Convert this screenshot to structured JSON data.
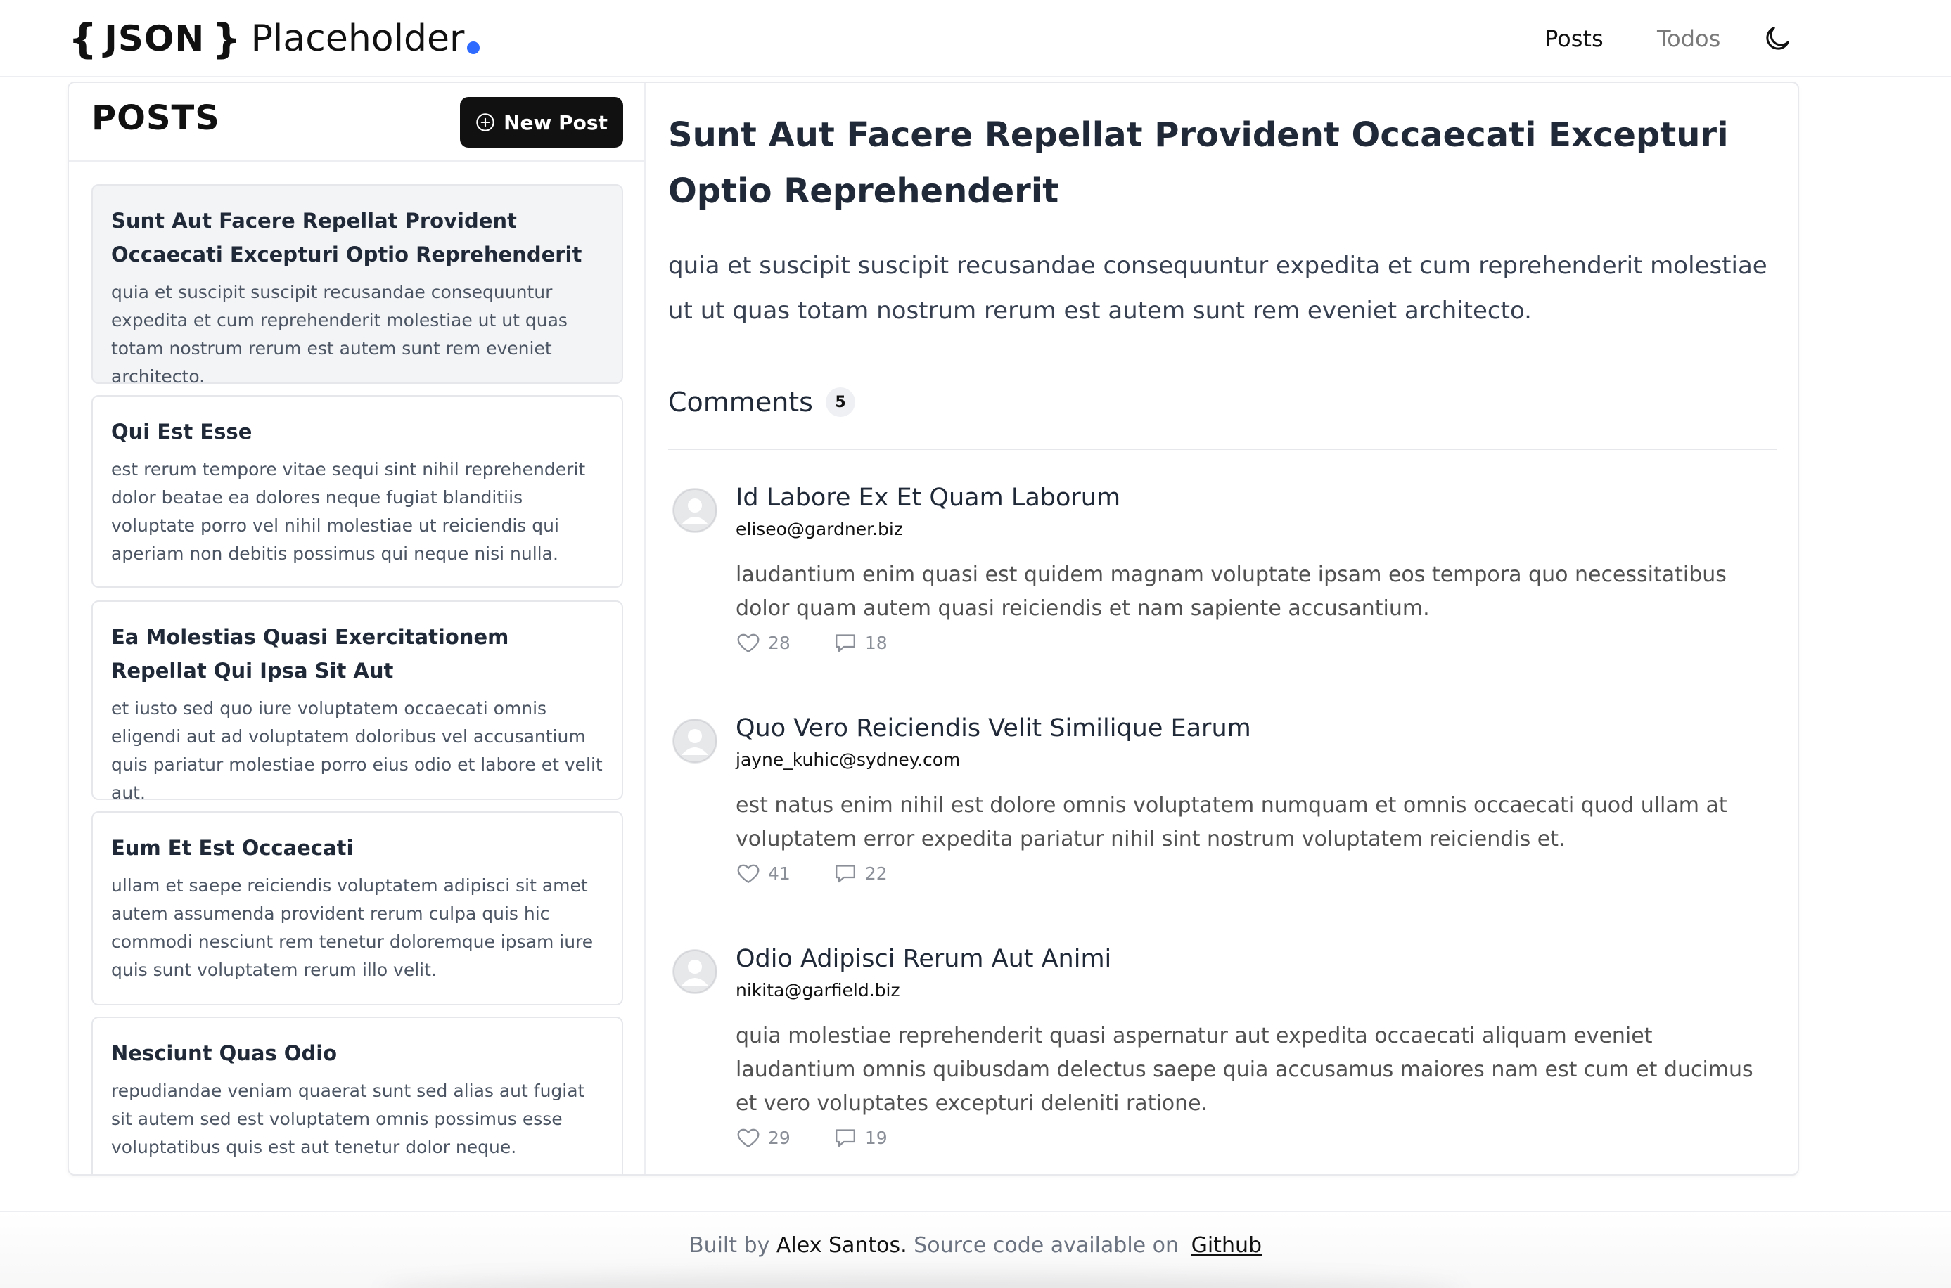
{
  "header": {
    "logo": {
      "brace_open": "{",
      "json": "JSON",
      "brace_close": "}",
      "placeholder": "Placeholder"
    },
    "nav": {
      "posts": "Posts",
      "todos": "Todos"
    },
    "theme_icon": "moon-icon"
  },
  "sidebar": {
    "title": "POSTS",
    "new_post_label": "New Post",
    "new_post_icon": "plus-circle-icon",
    "posts": [
      {
        "title": "Sunt Aut Facere Repellat Provident Occaecati Excepturi Optio Reprehenderit",
        "body": "quia et suscipit suscipit recusandae consequuntur expedita et cum reprehenderit molestiae ut ut quas totam nostrum rerum est autem sunt rem eveniet architecto."
      },
      {
        "title": "Qui Est Esse",
        "body": "est rerum tempore vitae sequi sint nihil reprehenderit dolor beatae ea dolores neque fugiat blanditiis voluptate porro vel nihil molestiae ut reiciendis qui aperiam non debitis possimus qui neque nisi nulla."
      },
      {
        "title": "Ea Molestias Quasi Exercitationem Repellat Qui Ipsa Sit Aut",
        "body": "et iusto sed quo iure voluptatem occaecati omnis eligendi aut ad voluptatem doloribus vel accusantium quis pariatur molestiae porro eius odio et labore et velit aut."
      },
      {
        "title": "Eum Et Est Occaecati",
        "body": "ullam et saepe reiciendis voluptatem adipisci sit amet autem assumenda provident rerum culpa quis hic commodi nesciunt rem tenetur doloremque ipsam iure quis sunt voluptatem rerum illo velit."
      },
      {
        "title": "Nesciunt Quas Odio",
        "body": "repudiandae veniam quaerat sunt sed alias aut fugiat sit autem sed est voluptatem omnis possimus esse voluptatibus quis est aut tenetur dolor neque."
      }
    ]
  },
  "detail": {
    "title": "Sunt Aut Facere Repellat Provident Occaecati Excepturi Optio Reprehenderit",
    "body": "quia et suscipit suscipit recusandae consequuntur expedita et cum reprehenderit molestiae ut ut quas totam nostrum rerum est autem sunt rem eveniet architecto.",
    "comments_label": "Comments",
    "comments_count": "5",
    "comments": [
      {
        "name": "Id Labore Ex Et Quam Laborum",
        "email": "eliseo@gardner.biz",
        "body": "laudantium enim quasi est quidem magnam voluptate ipsam eos tempora quo necessitatibus dolor quam autem quasi reiciendis et nam sapiente accusantium.",
        "likes": "28",
        "replies": "18"
      },
      {
        "name": "Quo Vero Reiciendis Velit Similique Earum",
        "email": "jayne_kuhic@sydney.com",
        "body": "est natus enim nihil est dolore omnis voluptatem numquam et omnis occaecati quod ullam at voluptatem error expedita pariatur nihil sint nostrum voluptatem reiciendis et.",
        "likes": "41",
        "replies": "22"
      },
      {
        "name": "Odio Adipisci Rerum Aut Animi",
        "email": "nikita@garfield.biz",
        "body": "quia molestiae reprehenderit quasi aspernatur aut expedita occaecati aliquam eveniet laudantium omnis quibusdam delectus saepe quia accusamus maiores nam est cum et ducimus et vero voluptates excepturi deleniti ratione.",
        "likes": "29",
        "replies": "19"
      }
    ]
  },
  "footer": {
    "built_by": "Built by",
    "author": "Alex Santos.",
    "source_text": "Source code available on",
    "github": "Github"
  },
  "colors": {
    "accent_dot": "#2f6bff",
    "button_bg": "#111111",
    "active_card_bg": "#f3f4f6"
  }
}
